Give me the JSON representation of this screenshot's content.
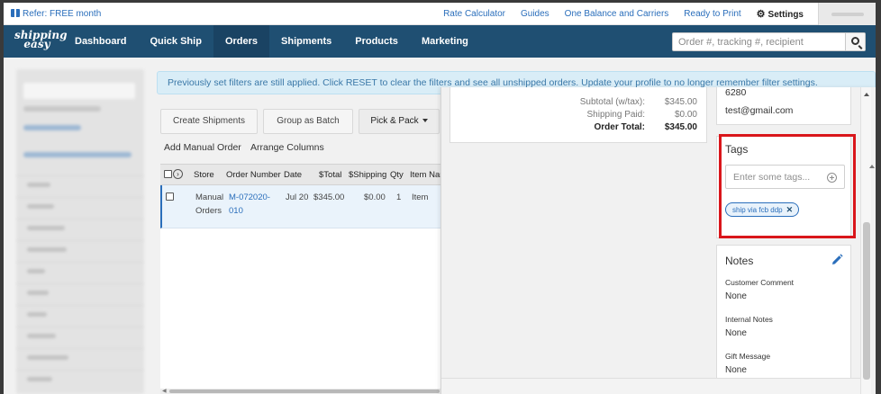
{
  "topbar": {
    "refer_label": "Refer: FREE month",
    "links": [
      "Rate Calculator",
      "Guides",
      "One Balance and Carriers",
      "Ready to Print"
    ],
    "settings_label": "Settings"
  },
  "nav": {
    "logo_line1": "shipping",
    "logo_line2": "easy",
    "items": [
      "Dashboard",
      "Quick Ship",
      "Orders",
      "Shipments",
      "Products",
      "Marketing"
    ],
    "active": "Orders",
    "search_placeholder": "Order #, tracking #, recipient"
  },
  "alert": {
    "text_before": "Previously set filters are still applied. Click ",
    "reset_link": "RESET",
    "text_middle": " to clear the filters and see all unshipped orders. ",
    "profile_link": "Update your profile",
    "text_after": " to no longer remember filter settings."
  },
  "orders": {
    "buttons": {
      "create_shipments": "Create Shipments",
      "group_as_batch": "Group as Batch",
      "pick_pack": "Pick & Pack"
    },
    "add_manual_order": "Add Manual Order",
    "arrange_columns": "Arrange Columns",
    "columns": [
      "Store",
      "Order Number",
      "Date",
      "$Total",
      "$Shipping",
      "Qty",
      "Item Nam"
    ],
    "rows": [
      {
        "store_line1": "Manual",
        "store_line2": "Orders",
        "order_line1": "M-072020-",
        "order_line2": "010",
        "date": "Jul 20",
        "total": "$345.00",
        "shipping": "$0.00",
        "qty": "1",
        "item": "Item"
      }
    ]
  },
  "summary": {
    "subtotal_label": "Subtotal (w/tax):",
    "subtotal_value": "$345.00",
    "shipping_paid_label": "Shipping Paid:",
    "shipping_paid_value": "$0.00",
    "order_total_label": "Order Total:",
    "order_total_value": "$345.00"
  },
  "contact": {
    "line1": "6280",
    "email": "test@gmail.com"
  },
  "tags": {
    "title": "Tags",
    "placeholder": "Enter some tags...",
    "chips": [
      "ship via fcb ddp"
    ]
  },
  "notes": {
    "title": "Notes",
    "customer_comment_label": "Customer Comment",
    "customer_comment_value": "None",
    "internal_notes_label": "Internal Notes",
    "internal_notes_value": "None",
    "gift_message_label": "Gift Message",
    "gift_message_value": "None"
  },
  "colors": {
    "nav_bg": "#1f4f72",
    "link": "#2a6ebb",
    "highlight": "#d9161b",
    "alert_bg": "#d9edf7"
  }
}
